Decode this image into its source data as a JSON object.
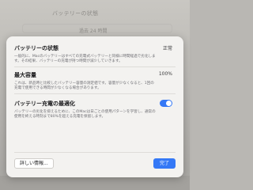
{
  "window": {
    "title": "バッテリーの状態",
    "tab_label": "過去 24 時間"
  },
  "sections": [
    {
      "title": "バッテリーの状態",
      "value": "正常",
      "description": "一般的に、Macのバッテリーはすべての充電式バッテリーと同様に時間経過で劣化します。その結果、バッテリーの充電が持つ時間が減少していきます。"
    },
    {
      "title": "最大容量",
      "value": "100%",
      "description": "これは、新品時と比較したバッテリー容量の測定値です。容量が少なくなると、1回の充電で使用できる時間が少なくなる場合があります。"
    },
    {
      "title": "バッテリー充電の最適化",
      "toggle_on": true,
      "description": "バッテリーの劣化を抑えるために、このMacは日ごとの使用パターンを学習し、通常の使用を終える時刻まで80%を超える充電を保留します。"
    }
  ],
  "buttons": {
    "more_info": "詳しい情報...",
    "done": "完了"
  },
  "colors": {
    "accent": "#3478f6",
    "sheet_background": "#f3f2f0"
  }
}
